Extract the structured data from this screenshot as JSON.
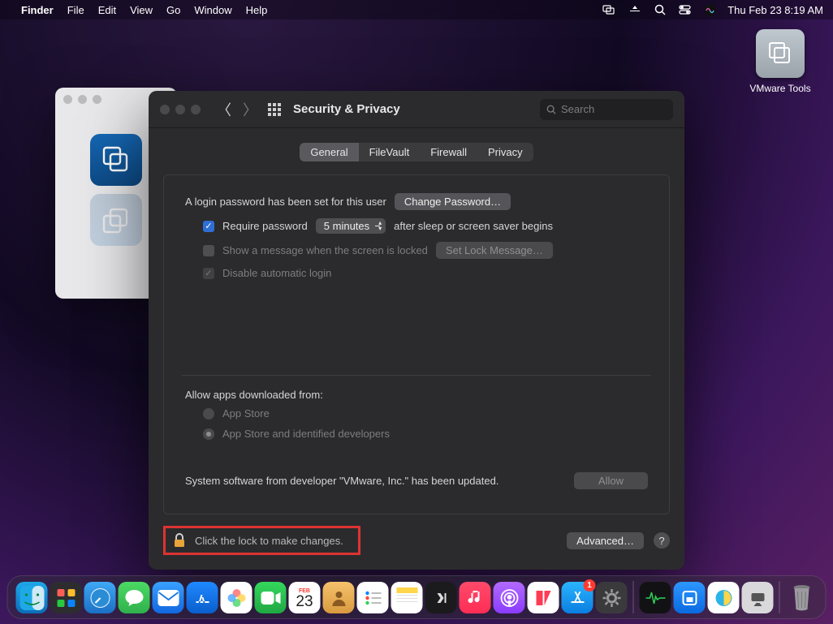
{
  "menubar": {
    "app": "Finder",
    "items": [
      "File",
      "Edit",
      "View",
      "Go",
      "Window",
      "Help"
    ],
    "clock": "Thu Feb 23  8:19 AM"
  },
  "desktop": {
    "vm_label": "VMware Tools"
  },
  "prefs": {
    "title": "Security & Privacy",
    "search_placeholder": "Search",
    "tabs": [
      "General",
      "FileVault",
      "Firewall",
      "Privacy"
    ],
    "login_pw_set": "A login password has been set for this user",
    "change_pw": "Change Password…",
    "require_pw": "Require password",
    "delay": "5 minutes",
    "after_sleep": "after sleep or screen saver begins",
    "show_msg": "Show a message when the screen is locked",
    "set_lock_msg": "Set Lock Message…",
    "disable_auto": "Disable automatic login",
    "allow_from": "Allow apps downloaded from:",
    "appstore": "App Store",
    "appstore_dev": "App Store and identified developers",
    "sys_software": "System software from developer \"VMware, Inc.\" has been updated.",
    "allow_btn": "Allow",
    "lock_text": "Click the lock to make changes.",
    "advanced": "Advanced…"
  },
  "dock": {
    "cal_month": "FEB",
    "cal_day": "23",
    "badge": "1"
  }
}
